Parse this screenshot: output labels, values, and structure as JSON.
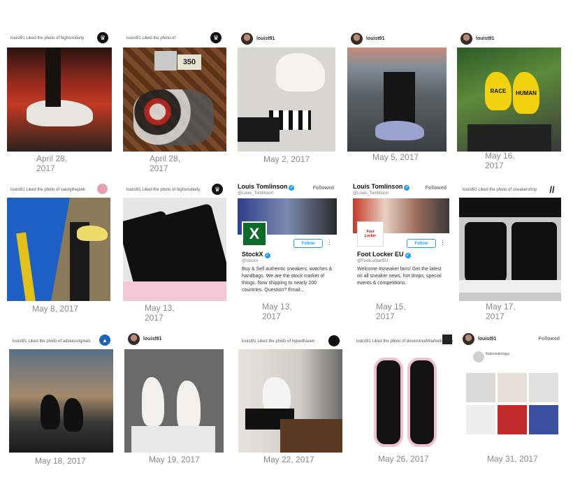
{
  "cards": [
    {
      "header": "louist91 Liked the photo of highsnobiety",
      "date": "April 28, 2017"
    },
    {
      "header": "louist91 Liked the photo of",
      "badge_text": "350",
      "date": "April 28, 2017"
    },
    {
      "header": "louist91",
      "date": "May 2, 2017"
    },
    {
      "header": "louist91",
      "date": "May 5, 2017"
    },
    {
      "header": "louist91",
      "shoe_text_1": "RACE",
      "shoe_text_2": "HUMAN",
      "date": "May 16, 2017"
    },
    {
      "header": "louist91 Liked the photo of vandythepink",
      "date": "May 8, 2017"
    },
    {
      "header": "louist91 Liked the photo of highsnobiety",
      "date": "May 13, 2017"
    },
    {
      "name": "Louis Tomlinson",
      "handle": "@Louis_Tomlinson",
      "followed": "Followed",
      "profile_name": "StockX",
      "profile_handle": "@stockx",
      "follow_label": "Follow",
      "bio": "Buy & Sell authentic sneakers, watches & handbags. We are the stock market of things. Now shipping to nearly 200 countries. Question? Email...",
      "date": "May 13, 2017"
    },
    {
      "name": "Louis Tomlinson",
      "handle": "@Louis_Tomlinson",
      "followed": "Followed",
      "profile_name": "Foot Locker EU",
      "profile_handle": "@FootLockerEU",
      "follow_label": "Follow",
      "bio": "Welcome #sneaker fans! Get the latest on all sneaker news, hot drops, special events & competitions.",
      "date": "May 15, 2017"
    },
    {
      "header": "louist91 Liked the photo of sneakershop",
      "date": "May 17, 2017"
    },
    {
      "header": "louist91 Liked the photo of adidasoriginals",
      "date": "May 18, 2017"
    },
    {
      "header": "louist91",
      "date": "May 19, 2017"
    },
    {
      "header": "louist91 Liked the photo of hypedhaven",
      "date": "May 22, 2017"
    },
    {
      "header": "louist91 Liked the photo of doverstreetmarketlondon",
      "date": "May 26, 2017"
    },
    {
      "header": "louist91",
      "followed": "Followed",
      "profile_handle": "thatsneakerguy",
      "date": "May 31, 2017"
    }
  ],
  "colors": {
    "date_gray": "#8a8a8a",
    "twitter_blue": "#1da1f2",
    "background": "#ffffff"
  }
}
